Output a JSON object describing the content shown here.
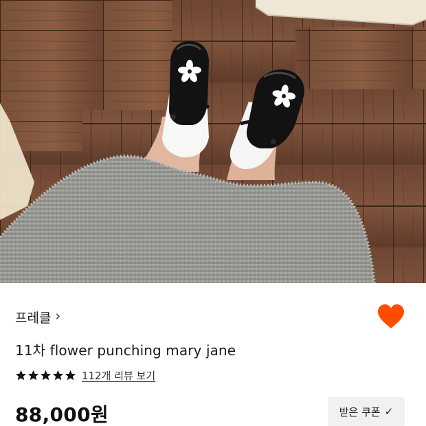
{
  "product": {
    "brand_label": "프레클",
    "title": "11차 flower punching mary jane",
    "rating_stars": 5,
    "review_link": "112개 리뷰 보기",
    "price": "88,000원",
    "coupon_label": "받은 쿠폰",
    "favorited": true
  },
  "icons": {
    "brand_chevron": "chevron-right-icon",
    "heart": "heart-icon",
    "star": "star-icon",
    "coupon_check": "check-icon"
  },
  "colors": {
    "heart": "#ff4d00",
    "star": "#111111",
    "coupon_bg": "#f1f1f1"
  }
}
